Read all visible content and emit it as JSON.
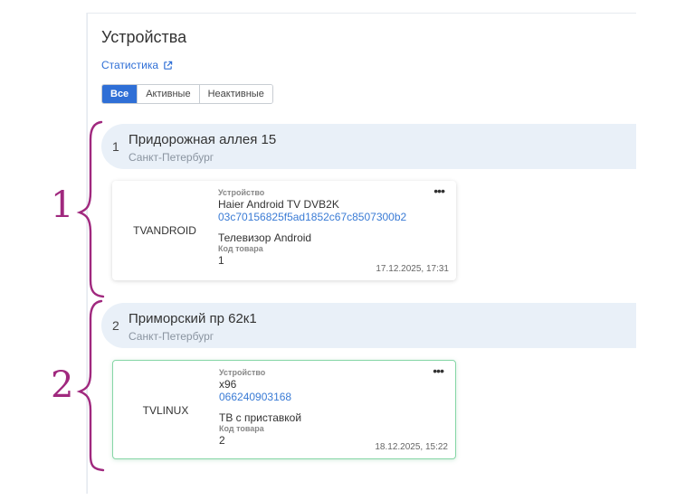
{
  "page": {
    "title": "Устройства",
    "stats_link": "Статистика"
  },
  "filters": [
    {
      "label": "Все",
      "active": true
    },
    {
      "label": "Активные",
      "active": false
    },
    {
      "label": "Неактивные",
      "active": false
    }
  ],
  "groups": [
    {
      "number": "1",
      "title": "Придорожная аллея 15",
      "city": "Санкт-Петербург",
      "device": {
        "type": "TVANDROID",
        "device_label": "Устройство",
        "device_name": "Haier Android TV DVB2K",
        "device_id": "03c70156825f5ad1852c67c8507300b2",
        "description": "Телевизор Android",
        "product_code_label": "Код товара",
        "product_code": "1",
        "date": "17.12.2025, 17:31"
      },
      "annotation": "1"
    },
    {
      "number": "2",
      "title": "Приморский пр 62к1",
      "city": "Санкт-Петербург",
      "device": {
        "type": "TVLINUX",
        "device_label": "Устройство",
        "device_name": "x96",
        "device_id": "066240903168",
        "description": "ТВ с приставкой",
        "product_code_label": "Код товара",
        "product_code": "2",
        "date": "18.12.2025, 15:22"
      },
      "annotation": "2"
    }
  ],
  "colors": {
    "accent": "#2f6fd6",
    "selected_border": "#86d6a6",
    "annotation": "#a0287e"
  },
  "icons": {
    "stats": "external-link-icon",
    "menu": "more-horizontal-icon"
  }
}
